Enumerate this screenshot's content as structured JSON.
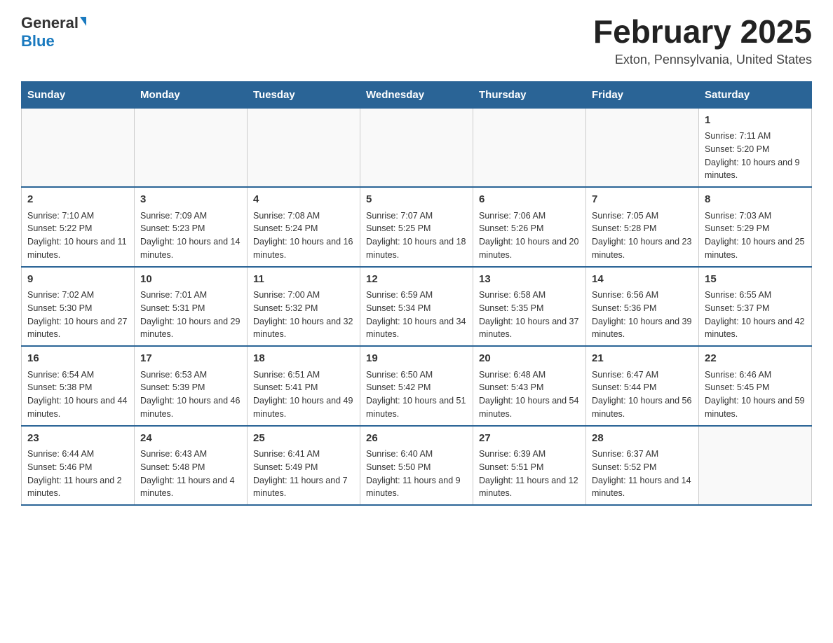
{
  "header": {
    "logo_general": "General",
    "logo_blue": "Blue",
    "month_title": "February 2025",
    "location": "Exton, Pennsylvania, United States"
  },
  "weekdays": [
    "Sunday",
    "Monday",
    "Tuesday",
    "Wednesday",
    "Thursday",
    "Friday",
    "Saturday"
  ],
  "weeks": [
    [
      {
        "day": "",
        "info": ""
      },
      {
        "day": "",
        "info": ""
      },
      {
        "day": "",
        "info": ""
      },
      {
        "day": "",
        "info": ""
      },
      {
        "day": "",
        "info": ""
      },
      {
        "day": "",
        "info": ""
      },
      {
        "day": "1",
        "info": "Sunrise: 7:11 AM\nSunset: 5:20 PM\nDaylight: 10 hours and 9 minutes."
      }
    ],
    [
      {
        "day": "2",
        "info": "Sunrise: 7:10 AM\nSunset: 5:22 PM\nDaylight: 10 hours and 11 minutes."
      },
      {
        "day": "3",
        "info": "Sunrise: 7:09 AM\nSunset: 5:23 PM\nDaylight: 10 hours and 14 minutes."
      },
      {
        "day": "4",
        "info": "Sunrise: 7:08 AM\nSunset: 5:24 PM\nDaylight: 10 hours and 16 minutes."
      },
      {
        "day": "5",
        "info": "Sunrise: 7:07 AM\nSunset: 5:25 PM\nDaylight: 10 hours and 18 minutes."
      },
      {
        "day": "6",
        "info": "Sunrise: 7:06 AM\nSunset: 5:26 PM\nDaylight: 10 hours and 20 minutes."
      },
      {
        "day": "7",
        "info": "Sunrise: 7:05 AM\nSunset: 5:28 PM\nDaylight: 10 hours and 23 minutes."
      },
      {
        "day": "8",
        "info": "Sunrise: 7:03 AM\nSunset: 5:29 PM\nDaylight: 10 hours and 25 minutes."
      }
    ],
    [
      {
        "day": "9",
        "info": "Sunrise: 7:02 AM\nSunset: 5:30 PM\nDaylight: 10 hours and 27 minutes."
      },
      {
        "day": "10",
        "info": "Sunrise: 7:01 AM\nSunset: 5:31 PM\nDaylight: 10 hours and 29 minutes."
      },
      {
        "day": "11",
        "info": "Sunrise: 7:00 AM\nSunset: 5:32 PM\nDaylight: 10 hours and 32 minutes."
      },
      {
        "day": "12",
        "info": "Sunrise: 6:59 AM\nSunset: 5:34 PM\nDaylight: 10 hours and 34 minutes."
      },
      {
        "day": "13",
        "info": "Sunrise: 6:58 AM\nSunset: 5:35 PM\nDaylight: 10 hours and 37 minutes."
      },
      {
        "day": "14",
        "info": "Sunrise: 6:56 AM\nSunset: 5:36 PM\nDaylight: 10 hours and 39 minutes."
      },
      {
        "day": "15",
        "info": "Sunrise: 6:55 AM\nSunset: 5:37 PM\nDaylight: 10 hours and 42 minutes."
      }
    ],
    [
      {
        "day": "16",
        "info": "Sunrise: 6:54 AM\nSunset: 5:38 PM\nDaylight: 10 hours and 44 minutes."
      },
      {
        "day": "17",
        "info": "Sunrise: 6:53 AM\nSunset: 5:39 PM\nDaylight: 10 hours and 46 minutes."
      },
      {
        "day": "18",
        "info": "Sunrise: 6:51 AM\nSunset: 5:41 PM\nDaylight: 10 hours and 49 minutes."
      },
      {
        "day": "19",
        "info": "Sunrise: 6:50 AM\nSunset: 5:42 PM\nDaylight: 10 hours and 51 minutes."
      },
      {
        "day": "20",
        "info": "Sunrise: 6:48 AM\nSunset: 5:43 PM\nDaylight: 10 hours and 54 minutes."
      },
      {
        "day": "21",
        "info": "Sunrise: 6:47 AM\nSunset: 5:44 PM\nDaylight: 10 hours and 56 minutes."
      },
      {
        "day": "22",
        "info": "Sunrise: 6:46 AM\nSunset: 5:45 PM\nDaylight: 10 hours and 59 minutes."
      }
    ],
    [
      {
        "day": "23",
        "info": "Sunrise: 6:44 AM\nSunset: 5:46 PM\nDaylight: 11 hours and 2 minutes."
      },
      {
        "day": "24",
        "info": "Sunrise: 6:43 AM\nSunset: 5:48 PM\nDaylight: 11 hours and 4 minutes."
      },
      {
        "day": "25",
        "info": "Sunrise: 6:41 AM\nSunset: 5:49 PM\nDaylight: 11 hours and 7 minutes."
      },
      {
        "day": "26",
        "info": "Sunrise: 6:40 AM\nSunset: 5:50 PM\nDaylight: 11 hours and 9 minutes."
      },
      {
        "day": "27",
        "info": "Sunrise: 6:39 AM\nSunset: 5:51 PM\nDaylight: 11 hours and 12 minutes."
      },
      {
        "day": "28",
        "info": "Sunrise: 6:37 AM\nSunset: 5:52 PM\nDaylight: 11 hours and 14 minutes."
      },
      {
        "day": "",
        "info": ""
      }
    ]
  ]
}
